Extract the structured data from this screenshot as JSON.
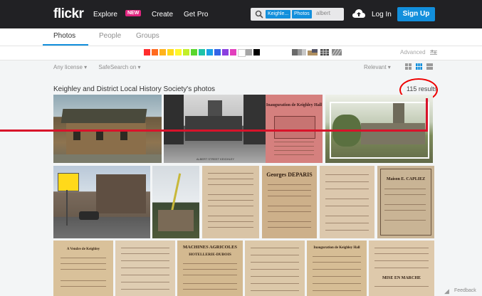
{
  "header": {
    "logo": "flickr",
    "nav": [
      "Explore",
      "Create",
      "Get Pro"
    ],
    "new_badge": "NEW",
    "search": {
      "tag1": "Keighle...",
      "tag2": "Photos",
      "query": "albert"
    },
    "login_label": "Log In",
    "signup_label": "Sign Up"
  },
  "tabs": [
    "Photos",
    "People",
    "Groups"
  ],
  "colors": {
    "swatches": [
      "#ff2d2d",
      "#ff6a1f",
      "#ffb21c",
      "#ffd91a",
      "#fff72b",
      "#c2ef28",
      "#59d62d",
      "#1ec3a8",
      "#1aa0e6",
      "#3464e6",
      "#8a3fe0",
      "#e23fbd",
      "#ffffff",
      "#a6a6a6",
      "#000000"
    ],
    "accent": "#128fdc",
    "annotation": "#e00000"
  },
  "advanced_label": "Advanced",
  "filters": {
    "license": "Any license ▾",
    "safesearch": "SafeSearch on ▾",
    "sort": "Relevant ▾"
  },
  "page_title": "Keighley and District Local History Society's photos",
  "results_label": "115 results",
  "documents": {
    "inauguration": "Inauguration de Keighley Hall",
    "georges": "Georges DEPARIS",
    "capliez": "Maison E. CAPLIEZ",
    "machines": "MACHINES AGRICOLES",
    "hotellerie": "HOTELLERIE-DUBOIS",
    "vendre": "A Vendre de Keighley",
    "mise": "MISE EN MARCHE",
    "albert_caption": "ALBERT STREET KEIGHLEY"
  },
  "feedback_label": "Feedback"
}
